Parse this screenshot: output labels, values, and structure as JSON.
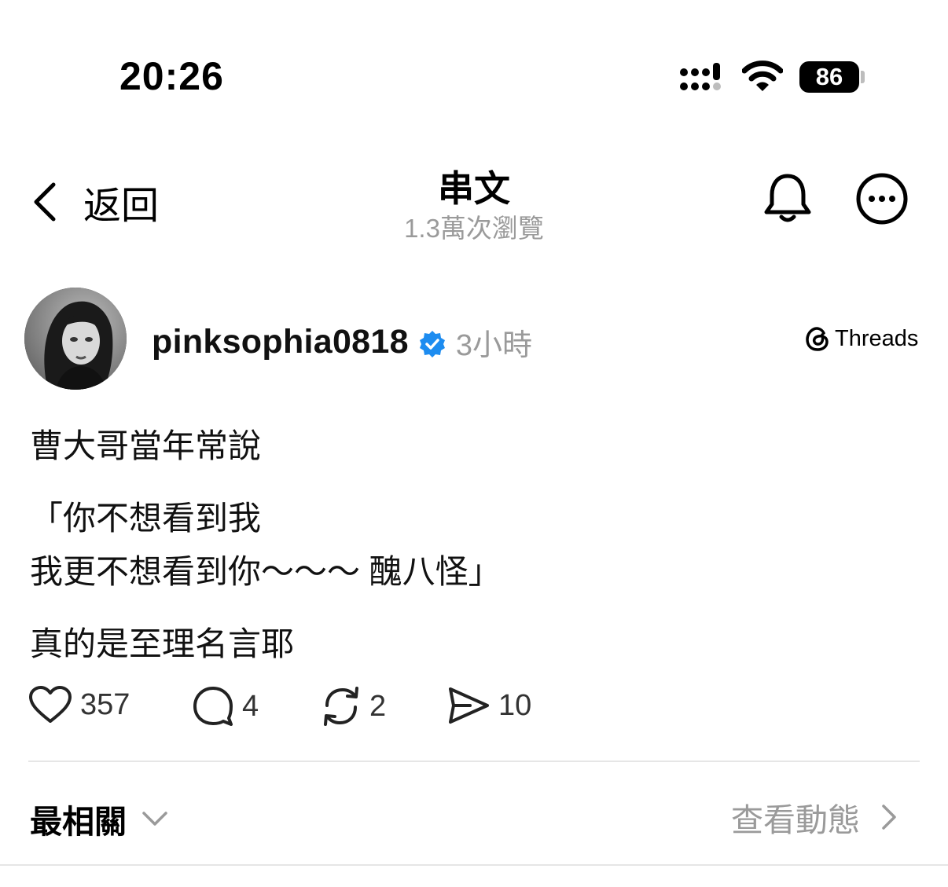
{
  "status_bar": {
    "time": "20:26",
    "battery": "86"
  },
  "nav": {
    "back_label": "返回",
    "title": "串文",
    "subtitle": "1.3萬次瀏覽"
  },
  "post": {
    "username": "pinksophia0818",
    "time": "3小時",
    "source": "Threads",
    "lines": [
      "曹大哥當年常說",
      "「你不想看到我",
      "我更不想看到你～～～ 醜八怪」",
      "真的是至理名言耶"
    ]
  },
  "actions": {
    "likes": "357",
    "comments": "4",
    "reposts": "2",
    "shares": "10"
  },
  "footer": {
    "sort_label": "最相關",
    "activity_label": "查看動態"
  }
}
